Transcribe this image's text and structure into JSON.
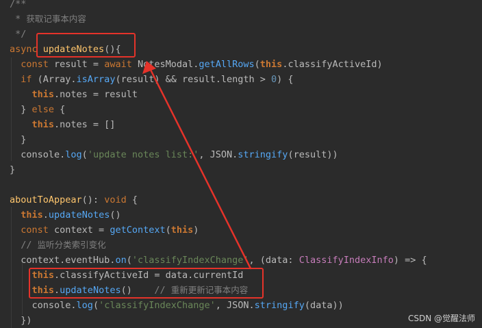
{
  "code_lines": [
    {
      "tokens": [
        {
          "t": "/**",
          "c": "comment"
        }
      ]
    },
    {
      "tokens": [
        {
          "t": " * ",
          "c": "comment"
        },
        {
          "t": "获取记事本内容",
          "c": "cmt-cn"
        }
      ]
    },
    {
      "tokens": [
        {
          "t": " */",
          "c": "comment"
        }
      ]
    },
    {
      "tokens": [
        {
          "t": "async ",
          "c": "keyword"
        },
        {
          "t": "updateNotes",
          "c": "fn"
        },
        {
          "t": "(){",
          "c": "plain"
        }
      ]
    },
    {
      "tokens": [
        {
          "t": "  const ",
          "c": "keyword"
        },
        {
          "t": "result = ",
          "c": "plain"
        },
        {
          "t": "await ",
          "c": "keyword"
        },
        {
          "t": "NotesModal.",
          "c": "plain"
        },
        {
          "t": "getAllRows",
          "c": "method"
        },
        {
          "t": "(",
          "c": "plain"
        },
        {
          "t": "this",
          "c": "this"
        },
        {
          "t": ".classifyActiveId)",
          "c": "plain"
        }
      ]
    },
    {
      "tokens": [
        {
          "t": "  if ",
          "c": "keyword"
        },
        {
          "t": "(Array.",
          "c": "plain"
        },
        {
          "t": "isArray",
          "c": "method"
        },
        {
          "t": "(result) && result.length > ",
          "c": "plain"
        },
        {
          "t": "0",
          "c": "num"
        },
        {
          "t": ") {",
          "c": "plain"
        }
      ]
    },
    {
      "tokens": [
        {
          "t": "    ",
          "c": "plain"
        },
        {
          "t": "this",
          "c": "this"
        },
        {
          "t": ".notes = result",
          "c": "plain"
        }
      ]
    },
    {
      "tokens": [
        {
          "t": "  } ",
          "c": "plain"
        },
        {
          "t": "else ",
          "c": "keyword"
        },
        {
          "t": "{",
          "c": "plain"
        }
      ]
    },
    {
      "tokens": [
        {
          "t": "    ",
          "c": "plain"
        },
        {
          "t": "this",
          "c": "this"
        },
        {
          "t": ".notes = []",
          "c": "plain"
        }
      ]
    },
    {
      "tokens": [
        {
          "t": "  }",
          "c": "plain"
        }
      ]
    },
    {
      "tokens": [
        {
          "t": "  console.",
          "c": "plain"
        },
        {
          "t": "log",
          "c": "method"
        },
        {
          "t": "(",
          "c": "plain"
        },
        {
          "t": "'update notes list:'",
          "c": "str"
        },
        {
          "t": ", JSON.",
          "c": "plain"
        },
        {
          "t": "stringify",
          "c": "method"
        },
        {
          "t": "(result))",
          "c": "plain"
        }
      ]
    },
    {
      "tokens": [
        {
          "t": "}",
          "c": "plain"
        }
      ]
    },
    {
      "tokens": []
    },
    {
      "tokens": [
        {
          "t": "aboutToAppear",
          "c": "fn"
        },
        {
          "t": "(): ",
          "c": "plain"
        },
        {
          "t": "void ",
          "c": "keyword"
        },
        {
          "t": "{",
          "c": "plain"
        }
      ]
    },
    {
      "tokens": [
        {
          "t": "  ",
          "c": "plain"
        },
        {
          "t": "this",
          "c": "this"
        },
        {
          "t": ".",
          "c": "plain"
        },
        {
          "t": "updateNotes",
          "c": "method"
        },
        {
          "t": "()",
          "c": "plain"
        }
      ]
    },
    {
      "tokens": [
        {
          "t": "  const ",
          "c": "keyword"
        },
        {
          "t": "context = ",
          "c": "plain"
        },
        {
          "t": "getContext",
          "c": "method"
        },
        {
          "t": "(",
          "c": "plain"
        },
        {
          "t": "this",
          "c": "this"
        },
        {
          "t": ")",
          "c": "plain"
        }
      ]
    },
    {
      "tokens": [
        {
          "t": "  // ",
          "c": "comment"
        },
        {
          "t": "监听分类索引变化",
          "c": "cmt-cn"
        }
      ]
    },
    {
      "tokens": [
        {
          "t": "  context.eventHub.",
          "c": "plain"
        },
        {
          "t": "on",
          "c": "method"
        },
        {
          "t": "(",
          "c": "plain"
        },
        {
          "t": "'classifyIndexChange'",
          "c": "str"
        },
        {
          "t": ", (data: ",
          "c": "plain"
        },
        {
          "t": "ClassifyIndexInfo",
          "c": "type"
        },
        {
          "t": ") => {",
          "c": "plain"
        }
      ]
    },
    {
      "tokens": [
        {
          "t": "    ",
          "c": "plain"
        },
        {
          "t": "this",
          "c": "this"
        },
        {
          "t": ".classifyActiveId = data.currentId",
          "c": "plain"
        }
      ]
    },
    {
      "tokens": [
        {
          "t": "    ",
          "c": "plain"
        },
        {
          "t": "this",
          "c": "this"
        },
        {
          "t": ".",
          "c": "plain"
        },
        {
          "t": "updateNotes",
          "c": "method"
        },
        {
          "t": "()    ",
          "c": "plain"
        },
        {
          "t": "// ",
          "c": "comment"
        },
        {
          "t": "重新更新记事本内容",
          "c": "cmt-cn"
        }
      ]
    },
    {
      "tokens": [
        {
          "t": "    console.",
          "c": "plain"
        },
        {
          "t": "log",
          "c": "method"
        },
        {
          "t": "(",
          "c": "plain"
        },
        {
          "t": "'classifyIndexChange'",
          "c": "str"
        },
        {
          "t": ", JSON.",
          "c": "plain"
        },
        {
          "t": "stringify",
          "c": "method"
        },
        {
          "t": "(data))",
          "c": "plain"
        }
      ]
    },
    {
      "tokens": [
        {
          "t": "  })",
          "c": "plain"
        }
      ]
    }
  ],
  "highlighted_line": 0,
  "watermark": "CSDN @觉醒法师",
  "colors": {
    "background": "#2b2b2b",
    "annotation": "#e5332a",
    "keyword": "#cc7832",
    "function": "#ffc66d",
    "method": "#56a8f5",
    "string": "#6a8759",
    "comment": "#808080",
    "number": "#6897bb",
    "type": "#c77dbb"
  }
}
